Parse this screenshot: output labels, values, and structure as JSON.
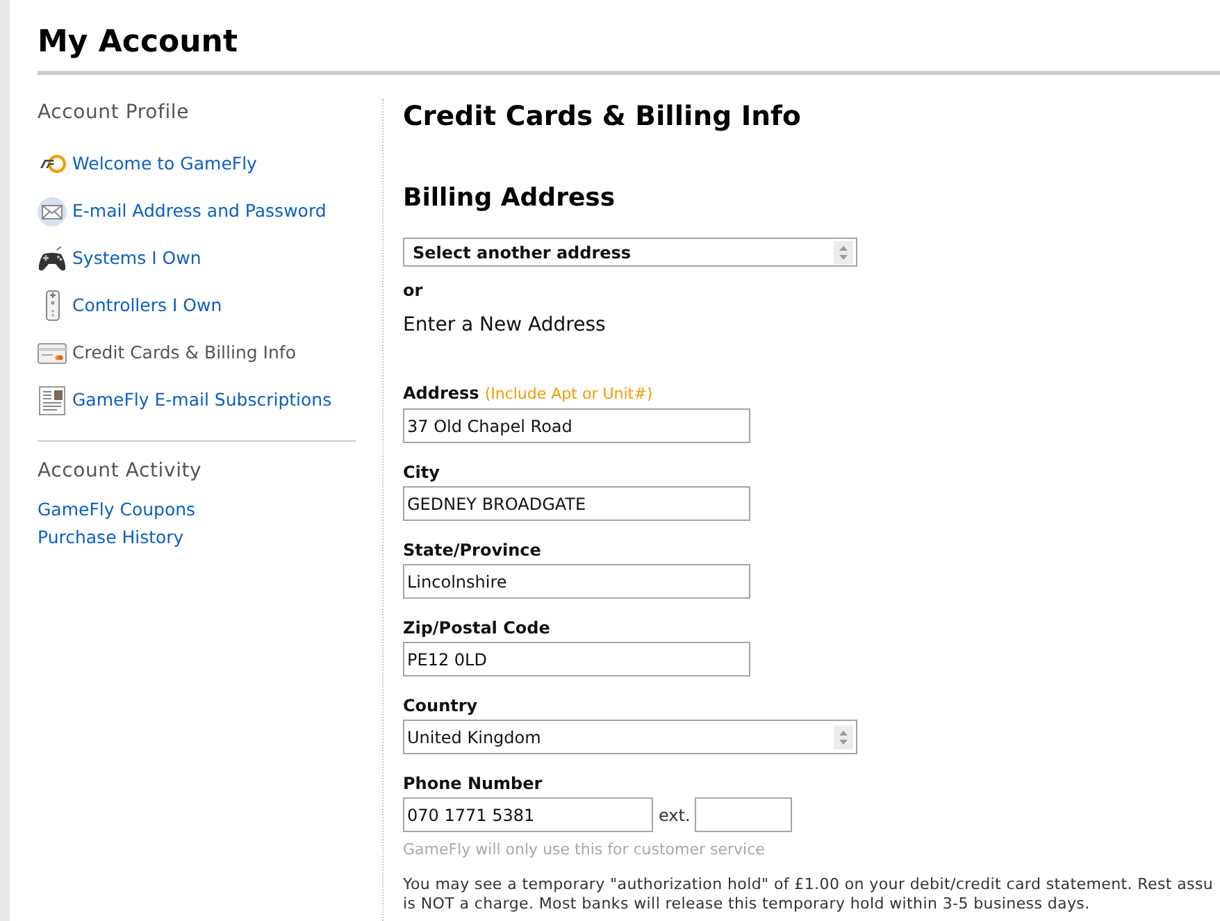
{
  "page": {
    "title": "My Account"
  },
  "sidebar": {
    "sections": [
      {
        "heading": "Account Profile",
        "kind": "icons",
        "items": [
          {
            "label": "Welcome to GameFly",
            "selected": false
          },
          {
            "label": "E-mail Address and Password",
            "selected": false
          },
          {
            "label": "Systems I Own",
            "selected": false
          },
          {
            "label": "Controllers I Own",
            "selected": false
          },
          {
            "label": "Credit Cards & Billing Info",
            "selected": true
          },
          {
            "label": "GameFly E-mail Subscriptions",
            "selected": false
          }
        ]
      },
      {
        "heading": "Account Activity",
        "kind": "links",
        "items": [
          {
            "label": "GameFly Coupons",
            "selected": false
          },
          {
            "label": "Purchase History",
            "selected": false
          }
        ]
      }
    ]
  },
  "main": {
    "title": "Credit Cards & Billing Info",
    "section_title": "Billing Address",
    "address_select": {
      "value": "Select another address"
    },
    "or_text": "or",
    "subtitle": "Enter a New Address",
    "fields": [
      {
        "kind": "text",
        "label": "Address",
        "note": "(Include Apt or Unit#)",
        "value": "37 Old Chapel Road"
      },
      {
        "kind": "text",
        "label": "City",
        "value": "GEDNEY BROADGATE"
      },
      {
        "kind": "text",
        "label": "State/Province",
        "value": "Lincolnshire"
      },
      {
        "kind": "text",
        "label": "Zip/Postal Code",
        "value": "PE12 0LD"
      },
      {
        "kind": "select",
        "label": "Country",
        "value": "United Kingdom"
      },
      {
        "kind": "phone",
        "label": "Phone Number",
        "value": "070 1771 5381",
        "ext_label": "ext.",
        "hint": "GameFly will only use this for customer service"
      }
    ],
    "notice": [
      "You may see a temporary \"authorization hold\" of £1.00 on your debit/credit card statement. Rest assu",
      "is NOT a charge. Most banks will release this temporary hold within 3-5 business days."
    ]
  }
}
